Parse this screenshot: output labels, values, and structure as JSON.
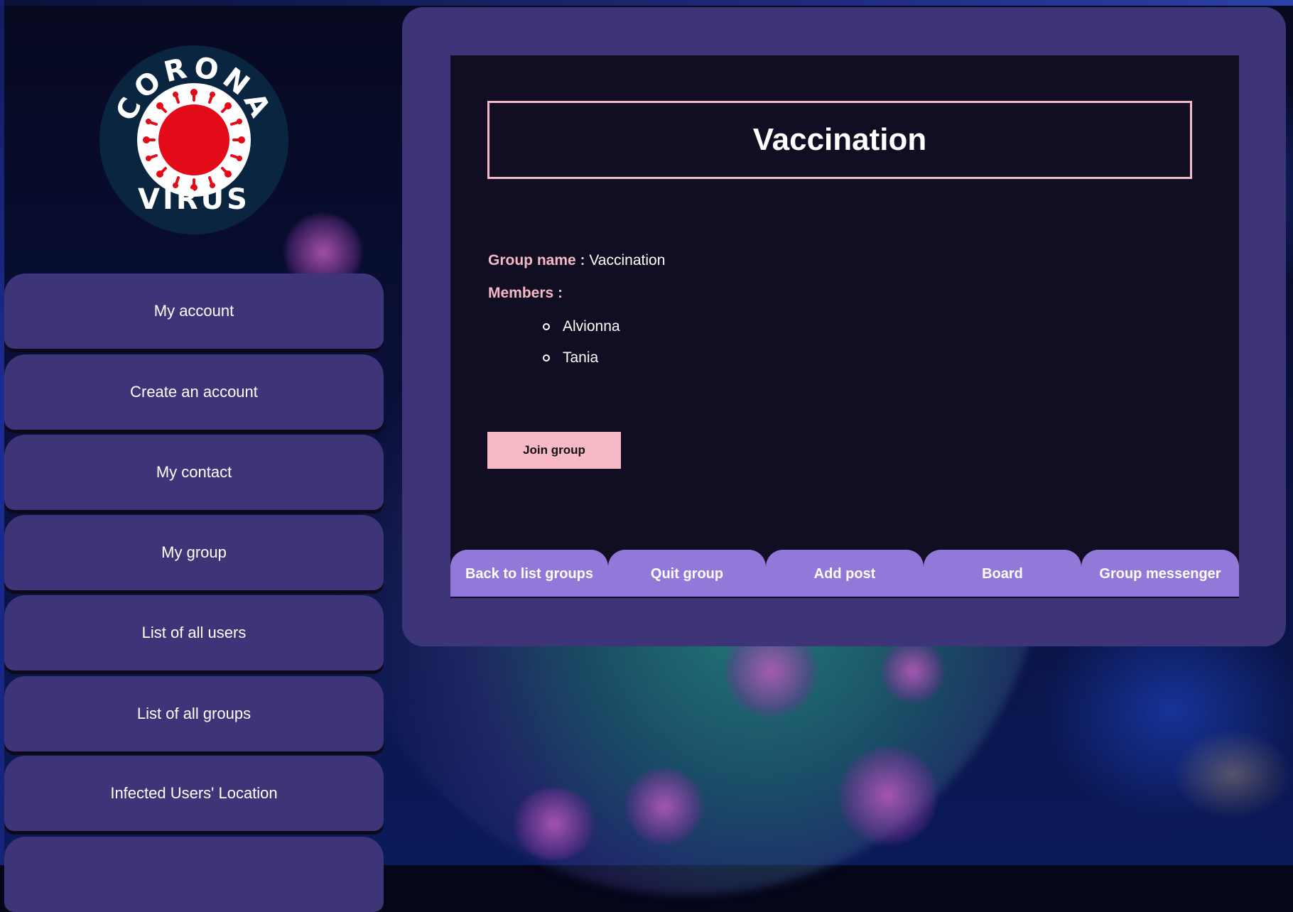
{
  "sidebar": {
    "logo": {
      "top_text": "CORONA",
      "bottom_text": "VIRUS"
    },
    "items": [
      {
        "label": "My account"
      },
      {
        "label": "Create an account"
      },
      {
        "label": "My contact"
      },
      {
        "label": "My group"
      },
      {
        "label": "List of all users"
      },
      {
        "label": "List of all groups"
      },
      {
        "label": "Infected Users' Location"
      },
      {
        "label": ""
      }
    ]
  },
  "group": {
    "title": "Vaccination",
    "name_label": "Group name :",
    "name_value": "Vaccination",
    "members_label": "Members :",
    "members": [
      "Alvionna",
      "Tania"
    ],
    "join_label": "Join group"
  },
  "tabs": [
    {
      "label": "Back to list groups"
    },
    {
      "label": "Quit group"
    },
    {
      "label": "Add post"
    },
    {
      "label": "Board"
    },
    {
      "label": "Group messenger"
    }
  ],
  "colors": {
    "panel": "#3e3578",
    "content_bg": "#110e24",
    "accent_pink": "#f4b8c6",
    "tab_purple": "#9278d8",
    "logo_red": "#e30b17",
    "logo_navy": "#0a2540"
  }
}
